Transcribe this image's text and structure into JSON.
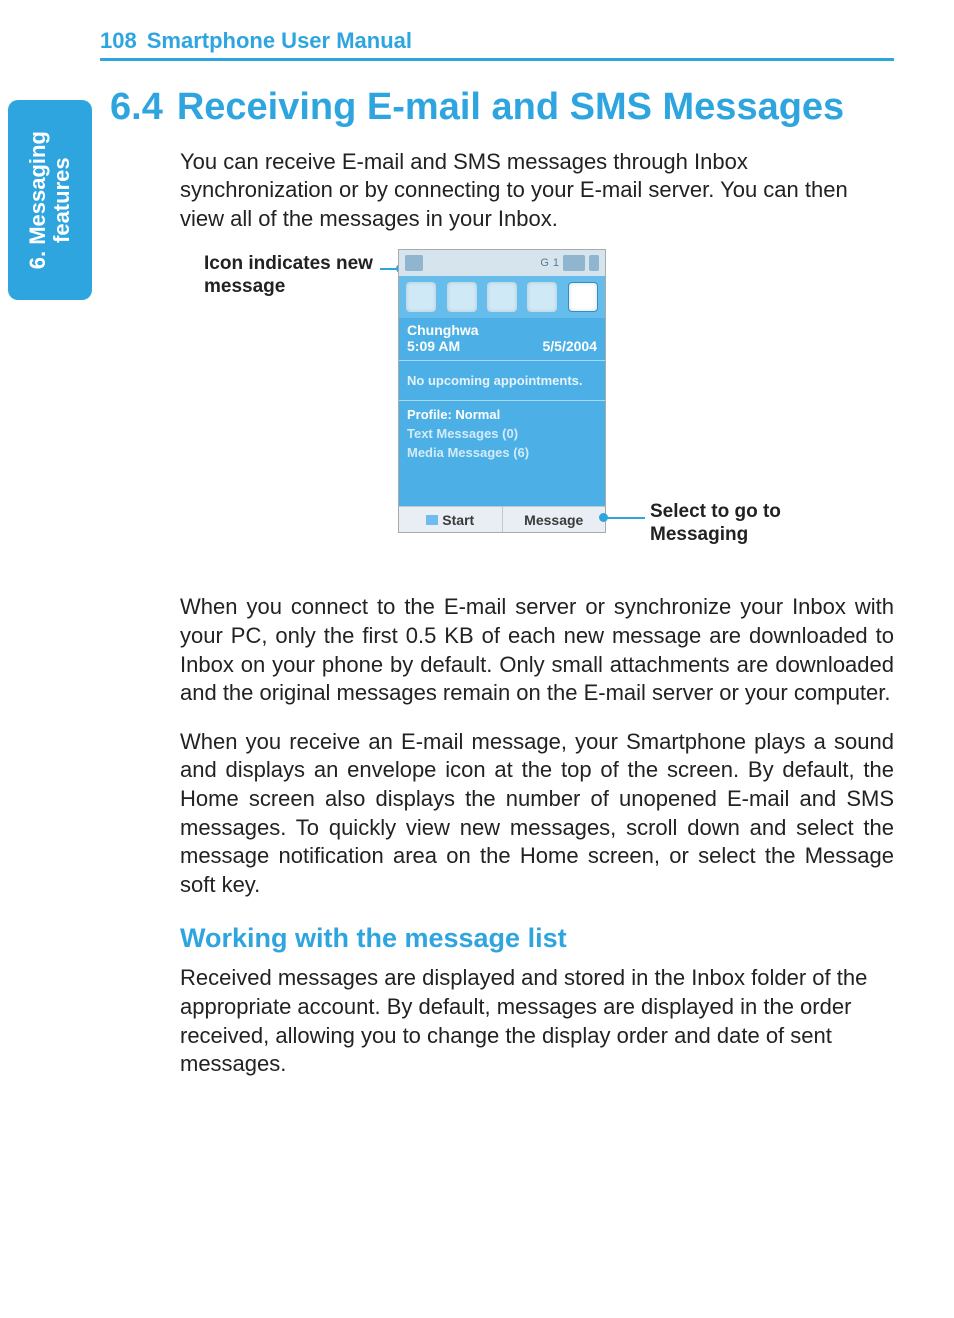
{
  "header": {
    "page_number": "108",
    "title": "Smartphone User Manual"
  },
  "side_tab": {
    "line1": "6. Messaging",
    "line2": "features"
  },
  "section": {
    "number": "6.4",
    "title": "Receiving E-mail and SMS Messages"
  },
  "paragraphs": {
    "intro": "You can receive E-mail and SMS messages through Inbox synchronization or by connecting to your E-mail server.  You can then view all of the messages in your Inbox.",
    "p2": "When you connect to the E-mail server or synchronize your Inbox with your PC, only the first 0.5 KB of each new message are downloaded to Inbox on your phone by default. Only small attachments are downloaded and the original messages remain on the E-mail server or your computer.",
    "p3": "When you receive an E-mail message, your Smartphone plays a sound and displays an envelope icon at the top of the screen.  By default, the Home screen also displays the number of unopened E-mail and SMS messages.  To quickly view new messages, scroll down and select the message notification area on the Home screen, or select the Message soft key.",
    "p4": "Received messages are displayed and stored in the Inbox folder of the appropriate account.  By default, messages are displayed in the order received, allowing you to change the display order and date of sent messages."
  },
  "callouts": {
    "left": "Icon indicates new message",
    "right": "Select to go to Messaging"
  },
  "phone": {
    "status_g": "G",
    "status_count": "1",
    "carrier": "Chunghwa",
    "time": "5:09 AM",
    "date": "5/5/2004",
    "appointments": "No upcoming appointments.",
    "profile": "Profile: Normal",
    "text_messages": "Text Messages (0)",
    "media_messages": "Media Messages (6)",
    "softkey_left": "Start",
    "softkey_right": "Message"
  },
  "subheading": "Working with the message list"
}
